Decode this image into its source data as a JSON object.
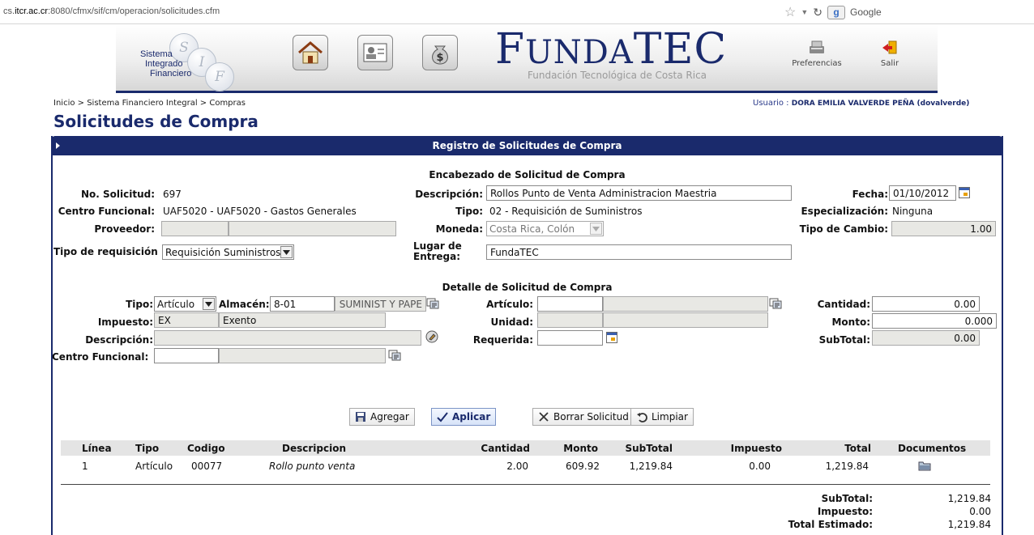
{
  "browser": {
    "url_prefix": "cs.",
    "url_host": "itcr.ac.cr",
    "url_rest": ":8080/cfmx/sif/cm/operacion/solicitudes.cfm",
    "search_engine": "Google"
  },
  "banner": {
    "sif_logo_lines": [
      "Sistema",
      "Integrado",
      "Financiero"
    ],
    "sif_letters": [
      "S",
      "I",
      "F"
    ],
    "fundatec_name_big": "F",
    "fundatec_name_rest": "UNDA",
    "fundatec_name_big2": "TEC",
    "fundatec_subtitle": "Fundación Tecnológica de Costa Rica",
    "preferences_label": "Preferencias",
    "logout_label": "Salir"
  },
  "breadcrumb": "Inicio > Sistema Financiero Integral > Compras",
  "user": {
    "label": "Usuario :",
    "name": "DORA EMILIA VALVERDE PEÑA (dovalverde)"
  },
  "page_title": "Solicitudes de Compra",
  "panel_title": "Registro de Solicitudes de Compra",
  "header": {
    "section_title": "Encabezado de Solicitud de Compra",
    "no_solicitud_label": "No. Solicitud:",
    "no_solicitud_value": "697",
    "centro_funcional_label": "Centro Funcional:",
    "centro_funcional_value": "UAF5020 - UAF5020 - Gastos Generales",
    "proveedor_label": "Proveedor:",
    "proveedor_code": "",
    "proveedor_name": "",
    "tipo_requisicion_label": "Tipo de requisición",
    "tipo_requisicion_value": "Requisición Suministros y Papelería",
    "descripcion_label": "Descripción:",
    "descripcion_value": "Rollos Punto de Venta Administracion Maestria",
    "tipo_label": "Tipo:",
    "tipo_value": "02 - Requisición de Suministros",
    "moneda_label": "Moneda:",
    "moneda_value": "Costa Rica, Colón",
    "lugar_label_1": "Lugar de",
    "lugar_label_2": "Entrega:",
    "lugar_value": "FundaTEC",
    "fecha_label": "Fecha:",
    "fecha_value": "01/10/2012",
    "especializacion_label": "Especialización:",
    "especializacion_value": "Ninguna",
    "tipo_cambio_label": "Tipo de Cambio:",
    "tipo_cambio_value": "1.00"
  },
  "detail": {
    "section_title": "Detalle de Solicitud de Compra",
    "tipo_label": "Tipo:",
    "tipo_value": "Artículo",
    "almacen_label": "Almacén:",
    "almacen_code": "8-01",
    "almacen_name": "SUMINIST Y PAPE",
    "impuesto_label": "Impuesto:",
    "impuesto_code": "EX",
    "impuesto_name": "Exento",
    "descripcion_label": "Descripción:",
    "descripcion_value": "",
    "centro_funcional_label": "Centro Funcional:",
    "centro_code": "",
    "centro_name": "",
    "articulo_label": "Artículo:",
    "articulo_code": "",
    "articulo_name": "",
    "unidad_label": "Unidad:",
    "unidad_code": "",
    "unidad_name": "",
    "requerida_label": "Requerida:",
    "requerida_value": "",
    "cantidad_label": "Cantidad:",
    "cantidad_value": "0.00",
    "monto_label": "Monto:",
    "monto_value": "0.000",
    "subtotal_label": "SubTotal:",
    "subtotal_value": "0.00"
  },
  "buttons": {
    "agregar": "Agregar",
    "aplicar": "Aplicar",
    "borrar": "Borrar Solicitud",
    "limpiar": "Limpiar"
  },
  "table": {
    "columns": [
      "Línea",
      "Tipo",
      "Codigo",
      "Descripcion",
      "Cantidad",
      "Monto",
      "SubTotal",
      "Impuesto",
      "Total",
      "Documentos"
    ],
    "rows": [
      {
        "linea": "1",
        "tipo": "Artículo",
        "codigo": "00077",
        "descripcion": "Rollo punto venta",
        "cantidad": "2.00",
        "monto": "609.92",
        "subtotal": "1,219.84",
        "impuesto": "0.00",
        "total": "1,219.84"
      }
    ]
  },
  "totals": {
    "subtotal_label": "SubTotal:",
    "subtotal_value": "1,219.84",
    "impuesto_label": "Impuesto:",
    "impuesto_value": "0.00",
    "estimado_label": "Total Estimado:",
    "estimado_value": "1,219.84"
  },
  "colors": {
    "navy": "#1a2a6c",
    "readonly_bg": "#e8e8e4"
  }
}
